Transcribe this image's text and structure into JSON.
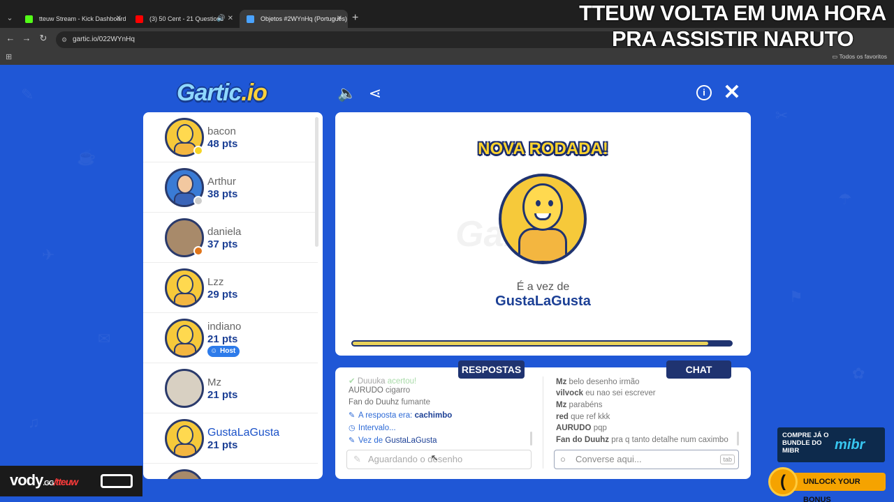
{
  "browser": {
    "tabs": [
      {
        "title": "tteuw Stream - Kick Dashboard",
        "favicon_color": "#53fc18"
      },
      {
        "title": "(3) 50 Cent - 21 Questions",
        "favicon_color": "#ff0000"
      },
      {
        "title": "Objetos #2WYnHq (Português)",
        "favicon_color": "#4aa3ff"
      }
    ],
    "url": "gartic.io/022WYnHq",
    "bookmarks_label": "Todos os favoritos"
  },
  "overlay": {
    "line1": "TTEUW VOLTA EM UMA HORA",
    "line2": "PRA ASSISTIR NARUTO"
  },
  "game": {
    "logo_main": "Gartic",
    "logo_suffix": ".io",
    "players": [
      {
        "name": "bacon",
        "points": "48 pts",
        "status_color": "#f5d425",
        "avatar": "default"
      },
      {
        "name": "Arthur",
        "points": "38 pts",
        "status_color": "#cccccc",
        "avatar": "arthur"
      },
      {
        "name": "daniela",
        "points": "37 pts",
        "status_color": "#e0751a",
        "avatar": "photo"
      },
      {
        "name": "Lzz",
        "points": "29 pts",
        "avatar": "default"
      },
      {
        "name": "indiano",
        "points": "21 pts",
        "avatar": "default",
        "badge": "Host"
      },
      {
        "name": "Mz",
        "points": "21 pts",
        "avatar": "photo2"
      },
      {
        "name": "GustaLaGusta",
        "points": "21 pts",
        "avatar": "default",
        "drawing": true
      }
    ],
    "board": {
      "heading": "NOVA RODADA!",
      "watermark": "Gartic",
      "turn_label": "É a vez de",
      "turn_player": "GustaLaGusta",
      "progress": 0.94
    },
    "answers": {
      "tab_label": "RESPOSTAS",
      "lines": [
        {
          "user": "Duuuka",
          "text": "acertou!",
          "type": "faded"
        },
        {
          "user": "AURUDO",
          "text": "cigarro",
          "type": "guess"
        },
        {
          "user": "Fan do Duuhz",
          "text": "fumante",
          "type": "guess"
        },
        {
          "prefix": "A resposta era:",
          "highlight": "cachimbo",
          "type": "sys",
          "icon": "pencil"
        },
        {
          "prefix": "Intervalo...",
          "highlight": "",
          "type": "sys",
          "icon": "clock"
        },
        {
          "prefix": "Vez de",
          "highlight": "GustaLaGusta",
          "type": "sys",
          "icon": "pencil"
        }
      ],
      "input_placeholder": "Aguardando o desenho"
    },
    "chat": {
      "tab_label": "CHAT",
      "lines": [
        {
          "user": "Mz",
          "text": "belo desenho irmão"
        },
        {
          "user": "vilvock",
          "text": "eu nao sei escrever"
        },
        {
          "user": "Mz",
          "text": "parabéns"
        },
        {
          "user": "red",
          "text": "que ref kkk"
        },
        {
          "user": "AURUDO",
          "text": "pqp"
        },
        {
          "user": "Fan do Duuhz",
          "text": "pra q tanto detalhe num caximbo"
        }
      ],
      "input_placeholder": "Converse aqui...",
      "tab_hint": "tab"
    }
  },
  "stream_widgets": {
    "vody_brand": "vody",
    "vody_suffix": ".GG",
    "vody_handle": "/tteuw",
    "mibr_text": "COMPRE JÁ O BUNDLE DO MIBR",
    "mibr_brand": "mibr",
    "unlock_label": "UNLOCK YOUR BONUS"
  }
}
